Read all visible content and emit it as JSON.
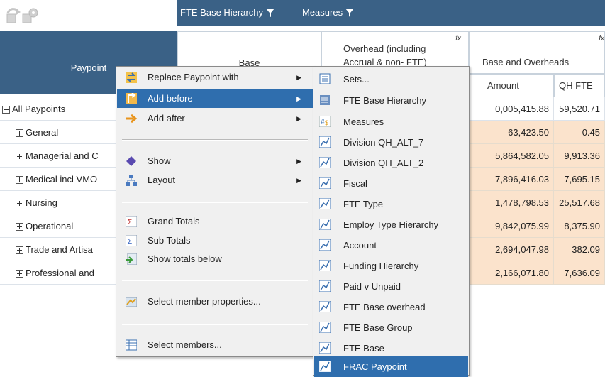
{
  "toolbar": {
    "fte_base_hierarchy": "FTE Base Hierarchy",
    "measures": "Measures"
  },
  "header": {
    "row_title": "Paypoint",
    "base": "Base",
    "overhead": "Overhead (including Accrual & non- FTE)",
    "base_and_overheads": "Base and Overheads",
    "amount": "Amount",
    "qh_fte": "QH FTE",
    "fx": "fx"
  },
  "rows": [
    {
      "label": "All Paypoints",
      "expanded": true,
      "amount": "0,005,415.88",
      "fte": "59,520.71"
    },
    {
      "label": "General",
      "amount": "63,423.50",
      "fte": "0.45"
    },
    {
      "label": "Managerial and C",
      "amount": "5,864,582.05",
      "fte": "9,913.36"
    },
    {
      "label": "Medical incl VMO",
      "amount": "7,896,416.03",
      "fte": "7,695.15"
    },
    {
      "label": "Nursing",
      "amount": "1,478,798.53",
      "fte": "25,517.68"
    },
    {
      "label": "Operational",
      "amount": "9,842,075.99",
      "fte": "8,375.90"
    },
    {
      "label": "Trade and Artisa",
      "amount": "2,694,047.98",
      "fte": "382.09"
    },
    {
      "label": "Professional and",
      "amount": "2,166,071.80",
      "fte": "7,636.09"
    }
  ],
  "context_menu": {
    "replace": "Replace Paypoint with",
    "add_before": "Add before",
    "add_after": "Add after",
    "show": "Show",
    "layout": "Layout",
    "grand_totals": "Grand Totals",
    "sub_totals": "Sub Totals",
    "show_totals_below": "Show totals below",
    "select_member_props": "Select member properties...",
    "select_members": "Select members..."
  },
  "submenu": [
    "Sets...",
    "FTE Base Hierarchy",
    "Measures",
    "Division QH_ALT_7",
    "Division QH_ALT_2",
    "Fiscal",
    "FTE Type",
    "Employ Type Hierarchy",
    "Account",
    "Funding Hierarchy",
    "Paid v Unpaid",
    "FTE Base overhead",
    "FTE Base Group",
    "FTE Base",
    "FRAC Paypoint"
  ],
  "colors": {
    "header_blue": "#3a6186",
    "selection_blue": "#2f6eae",
    "peach": "#fbe3cc"
  }
}
